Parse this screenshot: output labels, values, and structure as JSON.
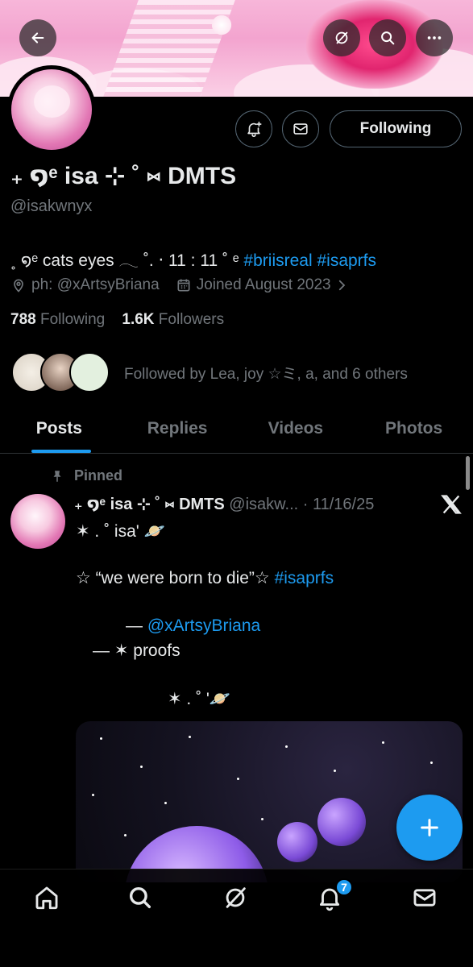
{
  "profile": {
    "display_name": "₊ ໑ᵉ isa ⊹ ˚ ⑅ DMTS",
    "handle": "@isakwnyx",
    "follow_button": "Following",
    "bio_text": "˳ ໑ᵉ cats eyes 𓂃 ˚. ‧ 11 : 11 ˚ ᵉ ",
    "bio_tags": [
      "#briisreal",
      "#isaprfs"
    ],
    "location": "ph: @xArtsyBriana",
    "joined": "Joined August 2023",
    "following_count": "788",
    "following_label": "Following",
    "followers_count": "1.6K",
    "followers_label": "Followers",
    "followed_by": "Followed by Lea, joy ☆ミ, a, and 6 others"
  },
  "tabs": [
    "Posts",
    "Replies",
    "Videos",
    "Photos"
  ],
  "post": {
    "pinned_label": "Pinned",
    "name": "₊ ໑ᵉ isa ⊹ ˚ ⑅ DMTS",
    "handle_date": "@isakw... · 11/16/25",
    "line1": "✶ . ˚ isa' 🪐",
    "line2_text": "☆ “we were born to die”☆ ",
    "line2_tag": "#isaprfs",
    "line3_dash": "— ",
    "line3_mention": "@xArtsyBriana",
    "line4": "— ✶ proofs",
    "line5": "✶ . ˚                '🪐"
  },
  "nav": {
    "notification_badge": "7"
  },
  "colors": {
    "accent": "#1d9bf0",
    "secondary_text": "#71767b",
    "background": "#000000"
  },
  "icons": [
    "back-arrow-icon",
    "grok-icon",
    "search-icon",
    "more-icon",
    "notification-bell-plus-icon",
    "mail-icon",
    "location-icon",
    "calendar-icon",
    "pin-icon",
    "x-logo-icon",
    "plus-icon",
    "home-icon",
    "bell-icon"
  ]
}
